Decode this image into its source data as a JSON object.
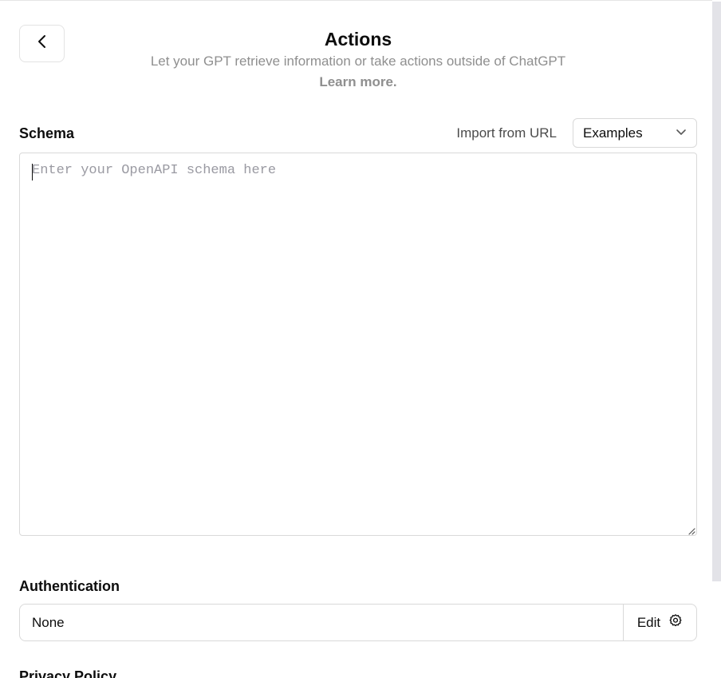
{
  "header": {
    "title": "Actions",
    "subtitle": "Let your GPT retrieve information or take actions outside of ChatGPT",
    "learn_more": "Learn more."
  },
  "schema": {
    "label": "Schema",
    "import_from_url": "Import from URL",
    "examples_selected": "Examples",
    "placeholder": "Enter your OpenAPI schema here",
    "value": ""
  },
  "authentication": {
    "label": "Authentication",
    "value": "None",
    "edit_label": "Edit"
  },
  "privacy": {
    "label": "Privacy Policy"
  },
  "icons": {
    "back": "chevron-left-icon",
    "dropdown": "chevron-down-icon",
    "settings": "gear-icon",
    "resize": "resize-handle-icon"
  },
  "colors": {
    "text": "#0d0d0d",
    "muted": "#8f8f8f",
    "border": "#d9d9d9",
    "placeholder": "#9a9aa2",
    "scrollbar": "#e3e3e8"
  }
}
